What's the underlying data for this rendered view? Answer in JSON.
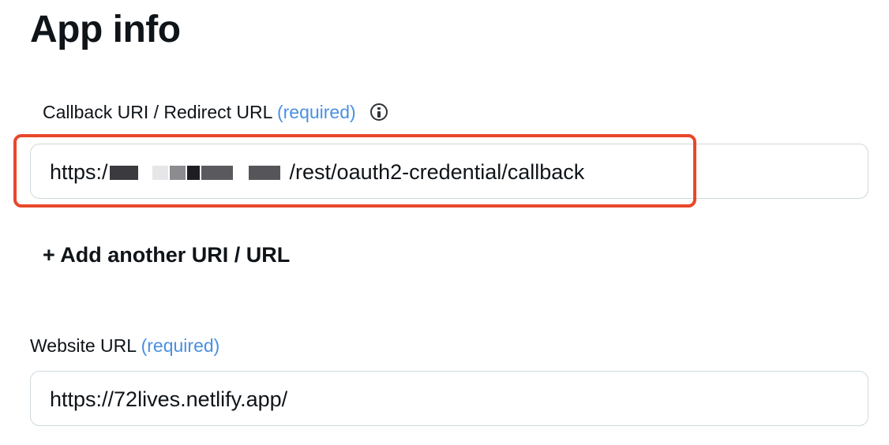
{
  "section": {
    "title": "App info"
  },
  "callback": {
    "label": "Callback URI / Redirect URL",
    "required": "(required)",
    "info_icon": "info-circle-icon",
    "value_prefix": "https:/",
    "value_suffix": "/rest/oauth2-credential/callback",
    "highlight_color": "#e8472b"
  },
  "add_uri": {
    "label": "+ Add another URI / URL"
  },
  "website": {
    "label": "Website URL",
    "required": "(required)",
    "value": "https://72lives.netlify.app/"
  },
  "colors": {
    "required_text": "#4a90e2",
    "input_border": "#cfd9de"
  }
}
